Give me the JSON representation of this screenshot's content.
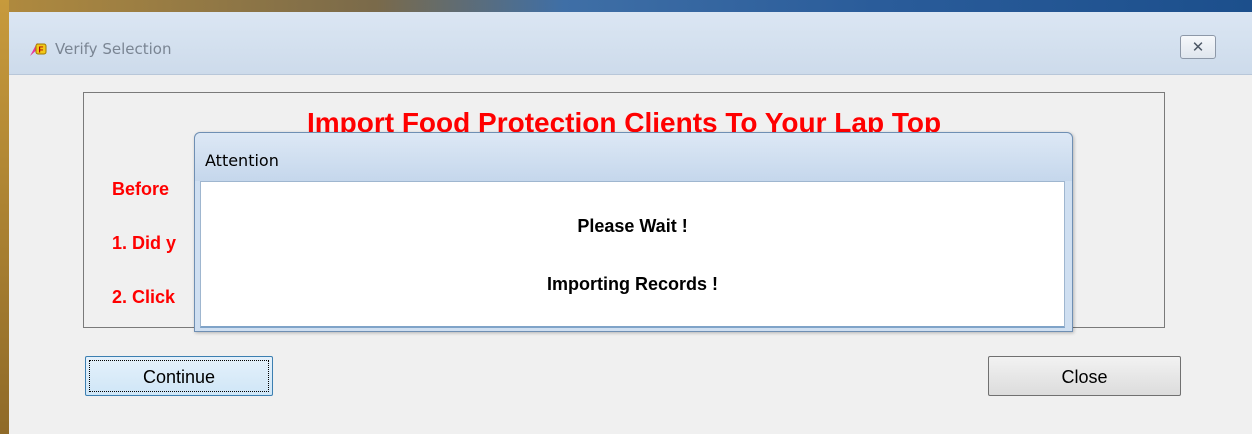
{
  "window": {
    "title": "Verify Selection",
    "close_glyph": "✕",
    "icon": "app-logo-icon"
  },
  "main": {
    "heading": "Import Food Protection Clients To Your Lap Top",
    "lines": [
      "Before",
      "1. Did y",
      "2. Click"
    ],
    "continue_label": "Continue",
    "close_label": "Close"
  },
  "dialog": {
    "title": "Attention",
    "message1": "Please Wait !",
    "message2": "Importing Records !"
  },
  "colors": {
    "warning_text": "#ff0000",
    "accent": "#3c7fb1"
  }
}
